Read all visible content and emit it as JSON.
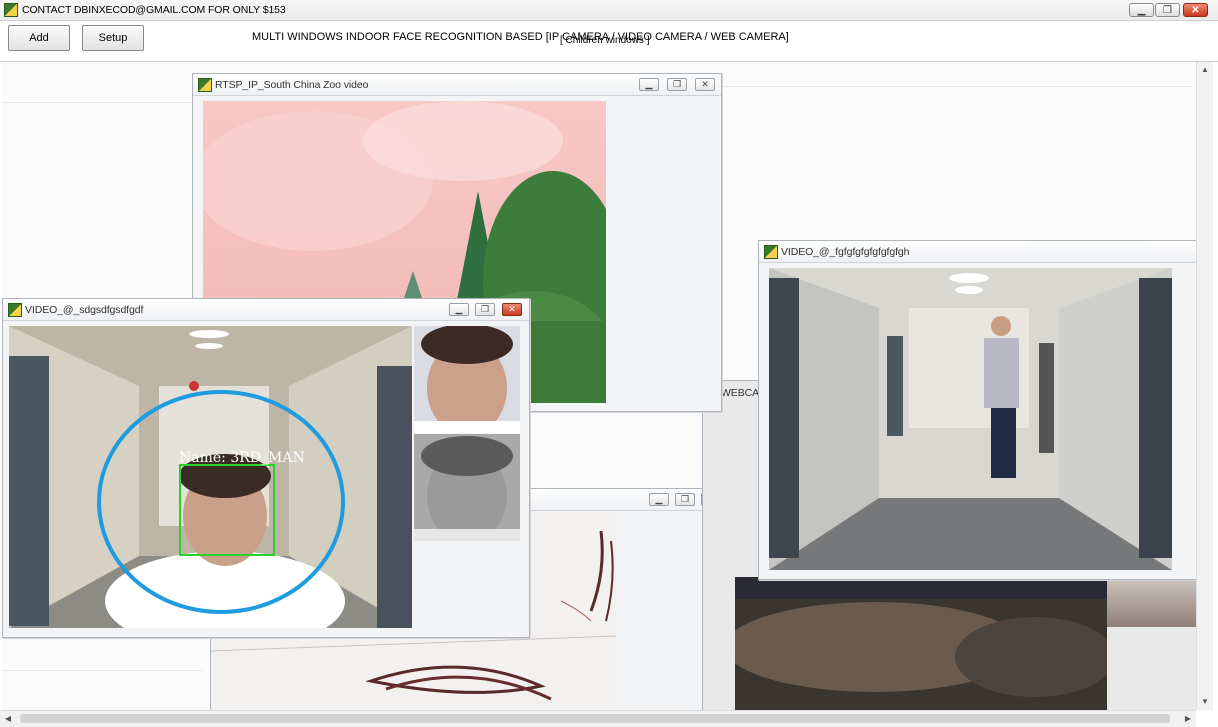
{
  "window": {
    "title": "CONTACT DBINXECOD@GMAIL.COM FOR ONLY $153",
    "min": "▁",
    "max": "❐",
    "close": "✕"
  },
  "toolbar": {
    "add_label": "Add",
    "setup_label": "Setup",
    "banner": "MULTI WINDOWS INDOOR FACE RECOGNITION BASED [IP CAMERA / VIDEO CAMERA / WEB CAMERA]",
    "children_label": "[ Children windows ]"
  },
  "children": {
    "zoo": {
      "title": "RTSP_IP_South China Zoo video"
    },
    "cam3": {
      "title": "VIDEO_@_sdgsdfgsdfgdf"
    },
    "video": {
      "title": "VIDEO_@_fgfgfgfgfgfgfgfgh"
    },
    "webcam": {
      "label": "WEBCAM"
    }
  },
  "recognition": {
    "name_label": "Name: 3RD_MAN"
  },
  "colors": {
    "accent_circle": "#1f9be0",
    "face_box": "#2ad12a"
  },
  "icons": [
    "app-icon",
    "minimize-icon",
    "maximize-icon",
    "close-icon",
    "scroll-up-icon",
    "scroll-down-icon",
    "scroll-left-icon",
    "scroll-right-icon"
  ]
}
